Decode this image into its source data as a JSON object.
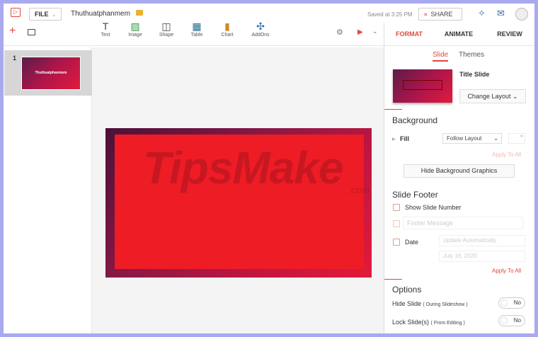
{
  "header": {
    "file_label": "FILE",
    "doc_title": "Thuthuatphanmem",
    "saved": "Saved at 3:25 PM",
    "share": "SHARE"
  },
  "toolbar": {
    "tools": [
      {
        "label": "Text",
        "icon": "T"
      },
      {
        "label": "Image",
        "icon": "▨"
      },
      {
        "label": "Shape",
        "icon": "◫"
      },
      {
        "label": "Table",
        "icon": "▦"
      },
      {
        "label": "Chart",
        "icon": "▮"
      },
      {
        "label": "AddOns",
        "icon": "✣"
      }
    ]
  },
  "slides": [
    {
      "number": "1",
      "title": "Thuthuatphanmem"
    }
  ],
  "watermark": "TipsMake",
  "watermark_suffix": ".com",
  "panel": {
    "tabs": [
      "FORMAT",
      "ANIMATE",
      "REVIEW"
    ],
    "subtabs": [
      "Slide",
      "Themes"
    ],
    "layout_name": "Title Slide",
    "change_layout": "Change Layout",
    "background": {
      "heading": "Background",
      "fill_label": "Fill",
      "fill_value": "Follow Layout",
      "apply_all": "Apply To All",
      "hide_bg": "Hide Background Graphics"
    },
    "footer": {
      "heading": "Slide Footer",
      "show_number": "Show Slide Number",
      "footer_placeholder": "Footer Message",
      "date_label": "Date",
      "date_mode": "Update Automatically",
      "date_value": "July 16, 2020",
      "apply_all": "Apply To All"
    },
    "options": {
      "heading": "Options",
      "hide_slide": "Hide Slide",
      "hide_slide_note": "( During Slideshow )",
      "hide_value": "No",
      "lock_slide": "Lock Slide(s)",
      "lock_slide_note": "( From Editing )",
      "lock_value": "No"
    }
  },
  "colors": {
    "accent": "#e0483e",
    "frame": "#a9a9ef"
  }
}
